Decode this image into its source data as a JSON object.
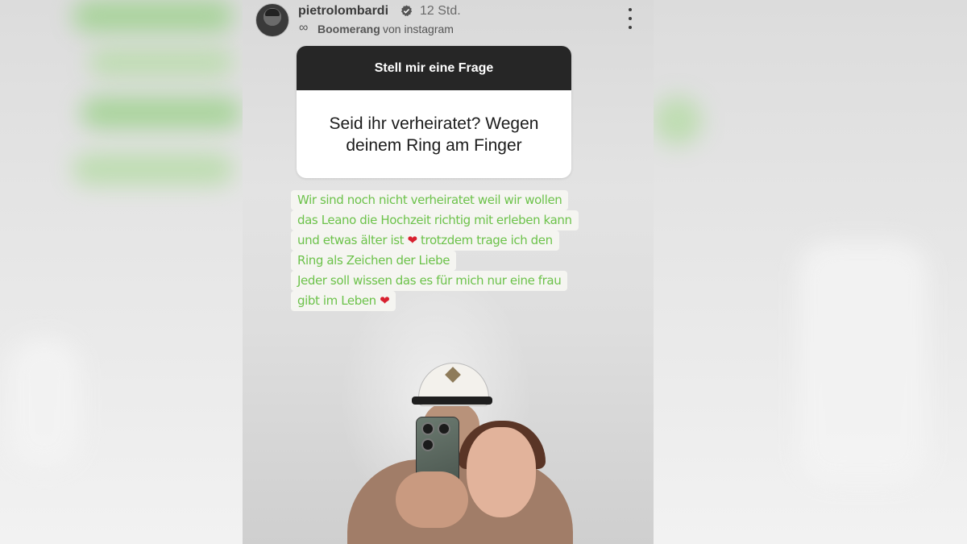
{
  "story": {
    "username": "pietrolombardi",
    "time": "12 Std.",
    "source_brand": "Boomerang",
    "source_via": "von instagram",
    "question_sticker": {
      "title": "Stell mir eine Frage",
      "question": "Seid ihr verheiratet? Wegen deinem Ring am Finger"
    },
    "answer_lines": [
      "Wir sind noch nicht verheiratet weil wir wollen",
      "das Leano die Hochzeit richtig mit erleben kann",
      "und etwas älter ist",
      "trotzdem trage ich den",
      "Ring als Zeichen der Liebe",
      "Jeder soll wissen das es für mich nur eine frau",
      "gibt im Leben"
    ]
  },
  "colors": {
    "answer_text": "#6cc24a",
    "heart": "#d8202f",
    "sticker_header": "#262626",
    "verified_badge": "#555555"
  },
  "icons": {
    "avatar": "profile-avatar",
    "verified": "verified-badge-icon",
    "boomerang": "infinity-icon",
    "more": "more-vertical-icon",
    "heart": "heart-emoji"
  }
}
